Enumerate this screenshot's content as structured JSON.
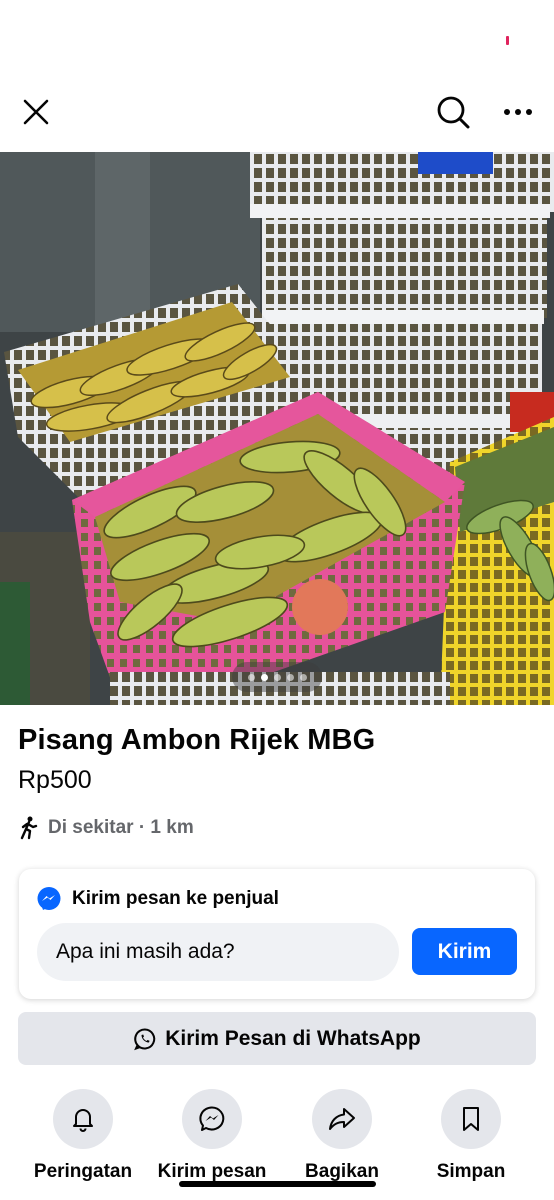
{
  "top_bar": {
    "close_icon": "close-icon",
    "search_icon": "search-icon",
    "more_icon": "more-horizontal-icon"
  },
  "photo": {
    "image_count": 5,
    "active_index": 1
  },
  "listing": {
    "title": "Pisang Ambon Rijek MBG",
    "price": "Rp500",
    "location": "Di sekitar · 1 km",
    "location_icon": "walking-person-icon"
  },
  "message_card": {
    "header": "Kirim pesan ke penjual",
    "header_icon": "messenger-icon",
    "input_value": "Apa ini masih ada?",
    "send_label": "Kirim"
  },
  "whatsapp": {
    "label": "Kirim Pesan di WhatsApp",
    "icon": "whatsapp-icon"
  },
  "actions": [
    {
      "label": "Peringatan",
      "icon": "bell-icon"
    },
    {
      "label": "Kirim pesan",
      "icon": "messenger-icon"
    },
    {
      "label": "Bagikan",
      "icon": "share-icon"
    },
    {
      "label": "Simpan",
      "icon": "bookmark-icon"
    }
  ],
  "colors": {
    "accent": "#0866ff",
    "secondary_text": "#65676b",
    "button_gray": "#e4e6eb",
    "input_bg": "#f0f2f5"
  }
}
